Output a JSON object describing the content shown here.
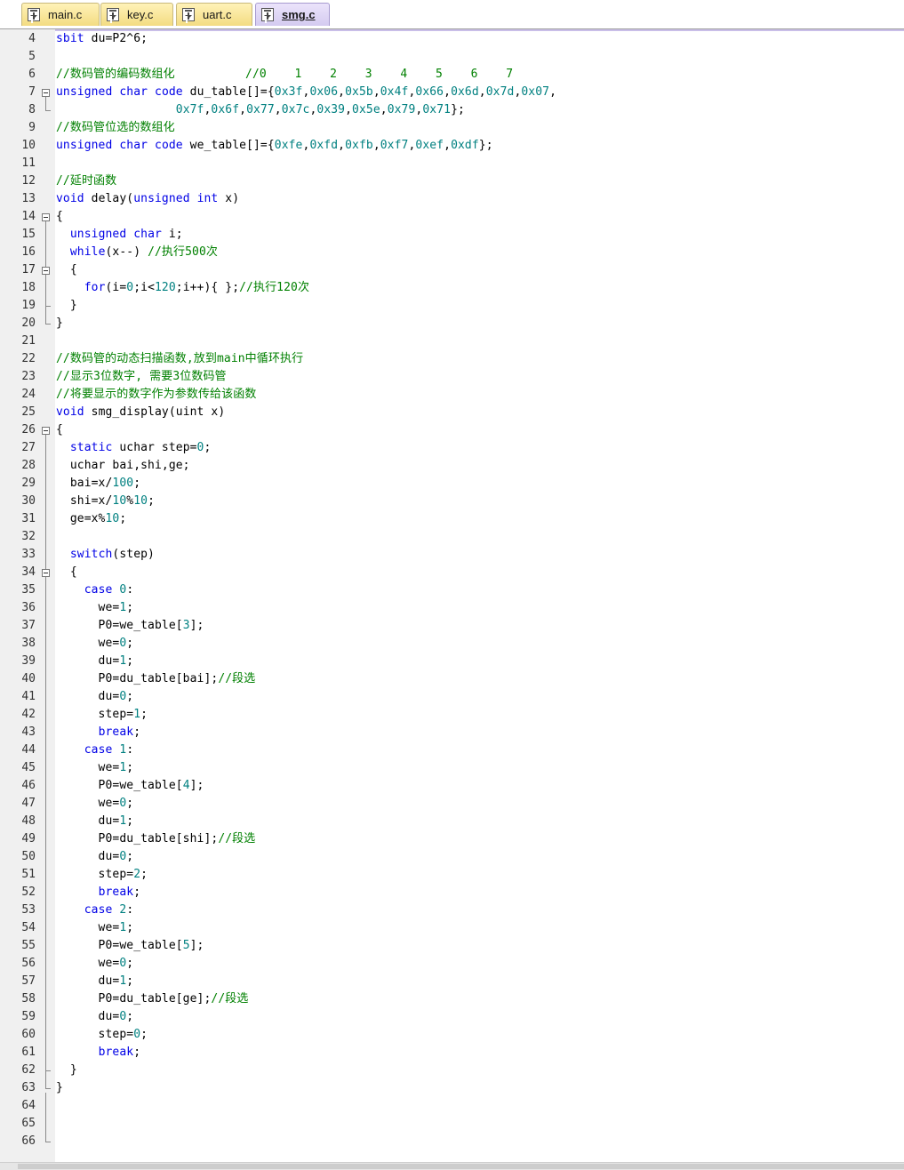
{
  "tabs": [
    {
      "label": "main.c",
      "active": false
    },
    {
      "label": "key.c",
      "active": false
    },
    {
      "label": "uart.c",
      "active": false
    },
    {
      "label": "smg.c",
      "active": true
    }
  ],
  "tab_icon": "c-file-icon",
  "colors": {
    "keyword": "#0000e6",
    "number": "#008080",
    "comment": "#008000",
    "gutter": "#f0f0f0",
    "active_tab": "#d4cbf0",
    "inactive_tab": "#f3dc82"
  },
  "lines": [
    {
      "n": "4",
      "tokens": [
        [
          "kw",
          "sbit"
        ],
        [
          "t",
          " du=P2^6;"
        ]
      ]
    },
    {
      "n": "5",
      "tokens": []
    },
    {
      "n": "6",
      "tokens": [
        [
          "cm",
          "//数码管的编码数组化          //0    1    2    3    4    5    6    7"
        ]
      ]
    },
    {
      "n": "7",
      "tokens": [
        [
          "kw",
          "unsigned"
        ],
        [
          "t",
          " "
        ],
        [
          "kw",
          "char"
        ],
        [
          "t",
          " "
        ],
        [
          "kw",
          "code"
        ],
        [
          "t",
          " du_table[]={"
        ],
        [
          "num",
          "0x3f"
        ],
        [
          "t",
          ","
        ],
        [
          "num",
          "0x06"
        ],
        [
          "t",
          ","
        ],
        [
          "num",
          "0x5b"
        ],
        [
          "t",
          ","
        ],
        [
          "num",
          "0x4f"
        ],
        [
          "t",
          ","
        ],
        [
          "num",
          "0x66"
        ],
        [
          "t",
          ","
        ],
        [
          "num",
          "0x6d"
        ],
        [
          "t",
          ","
        ],
        [
          "num",
          "0x7d"
        ],
        [
          "t",
          ","
        ],
        [
          "num",
          "0x07"
        ],
        [
          "t",
          ","
        ]
      ]
    },
    {
      "n": "8",
      "tokens": [
        [
          "t",
          "                 "
        ],
        [
          "num",
          "0x7f"
        ],
        [
          "t",
          ","
        ],
        [
          "num",
          "0x6f"
        ],
        [
          "t",
          ","
        ],
        [
          "num",
          "0x77"
        ],
        [
          "t",
          ","
        ],
        [
          "num",
          "0x7c"
        ],
        [
          "t",
          ","
        ],
        [
          "num",
          "0x39"
        ],
        [
          "t",
          ","
        ],
        [
          "num",
          "0x5e"
        ],
        [
          "t",
          ","
        ],
        [
          "num",
          "0x79"
        ],
        [
          "t",
          ","
        ],
        [
          "num",
          "0x71"
        ],
        [
          "t",
          "};"
        ]
      ]
    },
    {
      "n": "9",
      "tokens": [
        [
          "cm",
          "//数码管位选的数组化"
        ]
      ]
    },
    {
      "n": "10",
      "tokens": [
        [
          "kw",
          "unsigned"
        ],
        [
          "t",
          " "
        ],
        [
          "kw",
          "char"
        ],
        [
          "t",
          " "
        ],
        [
          "kw",
          "code"
        ],
        [
          "t",
          " we_table[]={"
        ],
        [
          "num",
          "0xfe"
        ],
        [
          "t",
          ","
        ],
        [
          "num",
          "0xfd"
        ],
        [
          "t",
          ","
        ],
        [
          "num",
          "0xfb"
        ],
        [
          "t",
          ","
        ],
        [
          "num",
          "0xf7"
        ],
        [
          "t",
          ","
        ],
        [
          "num",
          "0xef"
        ],
        [
          "t",
          ","
        ],
        [
          "num",
          "0xdf"
        ],
        [
          "t",
          "};"
        ]
      ]
    },
    {
      "n": "11",
      "tokens": []
    },
    {
      "n": "12",
      "tokens": [
        [
          "cm",
          "//延时函数"
        ]
      ]
    },
    {
      "n": "13",
      "tokens": [
        [
          "kw",
          "void"
        ],
        [
          "t",
          " delay("
        ],
        [
          "kw",
          "unsigned"
        ],
        [
          "t",
          " "
        ],
        [
          "kw",
          "int"
        ],
        [
          "t",
          " x)"
        ]
      ]
    },
    {
      "n": "14",
      "tokens": [
        [
          "t",
          "{"
        ]
      ]
    },
    {
      "n": "15",
      "tokens": [
        [
          "t",
          "  "
        ],
        [
          "kw",
          "unsigned"
        ],
        [
          "t",
          " "
        ],
        [
          "kw",
          "char"
        ],
        [
          "t",
          " i;"
        ]
      ]
    },
    {
      "n": "16",
      "tokens": [
        [
          "t",
          "  "
        ],
        [
          "kw",
          "while"
        ],
        [
          "t",
          "(x--) "
        ],
        [
          "cm",
          "//执行500次"
        ]
      ]
    },
    {
      "n": "17",
      "tokens": [
        [
          "t",
          "  {"
        ]
      ]
    },
    {
      "n": "18",
      "tokens": [
        [
          "t",
          "    "
        ],
        [
          "kw",
          "for"
        ],
        [
          "t",
          "(i="
        ],
        [
          "num",
          "0"
        ],
        [
          "t",
          ";i<"
        ],
        [
          "num",
          "120"
        ],
        [
          "t",
          ";i++){ };"
        ],
        [
          "cm",
          "//执行120次"
        ]
      ]
    },
    {
      "n": "19",
      "tokens": [
        [
          "t",
          "  }"
        ]
      ]
    },
    {
      "n": "20",
      "tokens": [
        [
          "t",
          "}"
        ]
      ]
    },
    {
      "n": "21",
      "tokens": []
    },
    {
      "n": "22",
      "tokens": [
        [
          "cm",
          "//数码管的动态扫描函数,放到main中循环执行"
        ]
      ]
    },
    {
      "n": "23",
      "tokens": [
        [
          "cm",
          "//显示3位数字, 需要3位数码管"
        ]
      ]
    },
    {
      "n": "24",
      "tokens": [
        [
          "cm",
          "//将要显示的数字作为参数传给该函数"
        ]
      ]
    },
    {
      "n": "25",
      "tokens": [
        [
          "kw",
          "void"
        ],
        [
          "t",
          " smg_display(uint x)"
        ]
      ]
    },
    {
      "n": "26",
      "tokens": [
        [
          "t",
          "{"
        ]
      ]
    },
    {
      "n": "27",
      "tokens": [
        [
          "t",
          "  "
        ],
        [
          "kw",
          "static"
        ],
        [
          "t",
          " uchar step="
        ],
        [
          "num",
          "0"
        ],
        [
          "t",
          ";"
        ]
      ]
    },
    {
      "n": "28",
      "tokens": [
        [
          "t",
          "  uchar bai,shi,ge;"
        ]
      ]
    },
    {
      "n": "29",
      "tokens": [
        [
          "t",
          "  bai=x/"
        ],
        [
          "num",
          "100"
        ],
        [
          "t",
          ";"
        ]
      ]
    },
    {
      "n": "30",
      "tokens": [
        [
          "t",
          "  shi=x/"
        ],
        [
          "num",
          "10"
        ],
        [
          "t",
          "%"
        ],
        [
          "num",
          "10"
        ],
        [
          "t",
          ";"
        ]
      ]
    },
    {
      "n": "31",
      "tokens": [
        [
          "t",
          "  ge=x%"
        ],
        [
          "num",
          "10"
        ],
        [
          "t",
          ";"
        ]
      ]
    },
    {
      "n": "32",
      "tokens": []
    },
    {
      "n": "33",
      "tokens": [
        [
          "t",
          "  "
        ],
        [
          "kw",
          "switch"
        ],
        [
          "t",
          "(step)"
        ]
      ]
    },
    {
      "n": "34",
      "tokens": [
        [
          "t",
          "  {"
        ]
      ]
    },
    {
      "n": "35",
      "tokens": [
        [
          "t",
          "    "
        ],
        [
          "kw",
          "case"
        ],
        [
          "t",
          " "
        ],
        [
          "num",
          "0"
        ],
        [
          "t",
          ":"
        ]
      ]
    },
    {
      "n": "36",
      "tokens": [
        [
          "t",
          "      we="
        ],
        [
          "num",
          "1"
        ],
        [
          "t",
          ";"
        ]
      ]
    },
    {
      "n": "37",
      "tokens": [
        [
          "t",
          "      P0=we_table["
        ],
        [
          "num",
          "3"
        ],
        [
          "t",
          "];"
        ]
      ]
    },
    {
      "n": "38",
      "tokens": [
        [
          "t",
          "      we="
        ],
        [
          "num",
          "0"
        ],
        [
          "t",
          ";"
        ]
      ]
    },
    {
      "n": "39",
      "tokens": [
        [
          "t",
          "      du="
        ],
        [
          "num",
          "1"
        ],
        [
          "t",
          ";"
        ]
      ]
    },
    {
      "n": "40",
      "tokens": [
        [
          "t",
          "      P0=du_table[bai];"
        ],
        [
          "cm",
          "//段选"
        ]
      ]
    },
    {
      "n": "41",
      "tokens": [
        [
          "t",
          "      du="
        ],
        [
          "num",
          "0"
        ],
        [
          "t",
          ";"
        ]
      ]
    },
    {
      "n": "42",
      "tokens": [
        [
          "t",
          "      step="
        ],
        [
          "num",
          "1"
        ],
        [
          "t",
          ";"
        ]
      ]
    },
    {
      "n": "43",
      "tokens": [
        [
          "t",
          "      "
        ],
        [
          "kw",
          "break"
        ],
        [
          "t",
          ";"
        ]
      ]
    },
    {
      "n": "44",
      "tokens": [
        [
          "t",
          "    "
        ],
        [
          "kw",
          "case"
        ],
        [
          "t",
          " "
        ],
        [
          "num",
          "1"
        ],
        [
          "t",
          ":"
        ]
      ]
    },
    {
      "n": "45",
      "tokens": [
        [
          "t",
          "      we="
        ],
        [
          "num",
          "1"
        ],
        [
          "t",
          ";"
        ]
      ]
    },
    {
      "n": "46",
      "tokens": [
        [
          "t",
          "      P0=we_table["
        ],
        [
          "num",
          "4"
        ],
        [
          "t",
          "];"
        ]
      ]
    },
    {
      "n": "47",
      "tokens": [
        [
          "t",
          "      we="
        ],
        [
          "num",
          "0"
        ],
        [
          "t",
          ";"
        ]
      ]
    },
    {
      "n": "48",
      "tokens": [
        [
          "t",
          "      du="
        ],
        [
          "num",
          "1"
        ],
        [
          "t",
          ";"
        ]
      ]
    },
    {
      "n": "49",
      "tokens": [
        [
          "t",
          "      P0=du_table[shi];"
        ],
        [
          "cm",
          "//段选"
        ]
      ]
    },
    {
      "n": "50",
      "tokens": [
        [
          "t",
          "      du="
        ],
        [
          "num",
          "0"
        ],
        [
          "t",
          ";"
        ]
      ]
    },
    {
      "n": "51",
      "tokens": [
        [
          "t",
          "      step="
        ],
        [
          "num",
          "2"
        ],
        [
          "t",
          ";"
        ]
      ]
    },
    {
      "n": "52",
      "tokens": [
        [
          "t",
          "      "
        ],
        [
          "kw",
          "break"
        ],
        [
          "t",
          ";"
        ]
      ]
    },
    {
      "n": "53",
      "tokens": [
        [
          "t",
          "    "
        ],
        [
          "kw",
          "case"
        ],
        [
          "t",
          " "
        ],
        [
          "num",
          "2"
        ],
        [
          "t",
          ":"
        ]
      ]
    },
    {
      "n": "54",
      "tokens": [
        [
          "t",
          "      we="
        ],
        [
          "num",
          "1"
        ],
        [
          "t",
          ";"
        ]
      ]
    },
    {
      "n": "55",
      "tokens": [
        [
          "t",
          "      P0=we_table["
        ],
        [
          "num",
          "5"
        ],
        [
          "t",
          "];"
        ]
      ]
    },
    {
      "n": "56",
      "tokens": [
        [
          "t",
          "      we="
        ],
        [
          "num",
          "0"
        ],
        [
          "t",
          ";"
        ]
      ]
    },
    {
      "n": "57",
      "tokens": [
        [
          "t",
          "      du="
        ],
        [
          "num",
          "1"
        ],
        [
          "t",
          ";"
        ]
      ]
    },
    {
      "n": "58",
      "tokens": [
        [
          "t",
          "      P0=du_table[ge];"
        ],
        [
          "cm",
          "//段选"
        ]
      ]
    },
    {
      "n": "59",
      "tokens": [
        [
          "t",
          "      du="
        ],
        [
          "num",
          "0"
        ],
        [
          "t",
          ";"
        ]
      ]
    },
    {
      "n": "60",
      "tokens": [
        [
          "t",
          "      step="
        ],
        [
          "num",
          "0"
        ],
        [
          "t",
          ";"
        ]
      ]
    },
    {
      "n": "61",
      "tokens": [
        [
          "t",
          "      "
        ],
        [
          "kw",
          "break"
        ],
        [
          "t",
          ";"
        ]
      ]
    },
    {
      "n": "62",
      "tokens": [
        [
          "t",
          "  }"
        ]
      ]
    },
    {
      "n": "63",
      "tokens": [
        [
          "t",
          "}"
        ]
      ]
    },
    {
      "n": "64",
      "tokens": []
    },
    {
      "n": "65",
      "tokens": []
    },
    {
      "n": "66",
      "tokens": []
    }
  ]
}
